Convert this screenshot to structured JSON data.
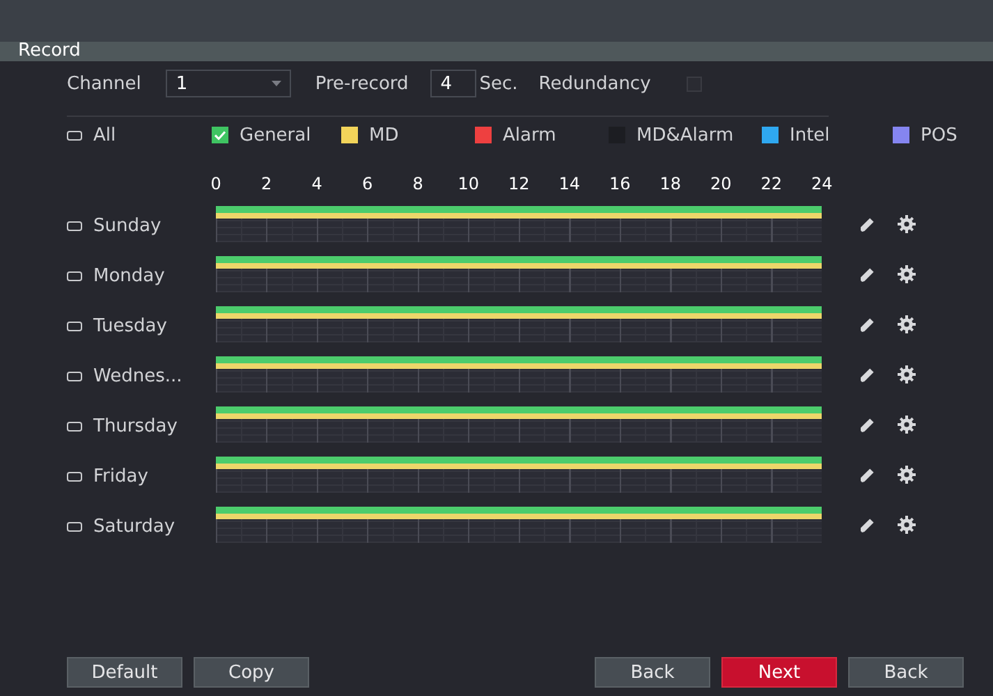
{
  "title": "Record",
  "settings": {
    "channel_label": "Channel",
    "channel_value": "1",
    "prerecord_label": "Pre-record",
    "prerecord_value": "4",
    "prerecord_unit": "Sec.",
    "redundancy_label": "Redundancy",
    "redundancy_checked": false
  },
  "legend": [
    {
      "label": "All",
      "kind": "checkbox",
      "checked": false
    },
    {
      "label": "General",
      "kind": "swatch",
      "color": "#3fc462",
      "checked": true
    },
    {
      "label": "MD",
      "kind": "swatch",
      "color": "#f2d45a",
      "checked": false
    },
    {
      "label": "Alarm",
      "kind": "swatch",
      "color": "#ee4040",
      "checked": false
    },
    {
      "label": "MD&Alarm",
      "kind": "swatch",
      "color": "#1c1d22",
      "checked": false
    },
    {
      "label": "Intel",
      "kind": "swatch",
      "color": "#2fa8f0",
      "checked": false
    },
    {
      "label": "POS",
      "kind": "swatch",
      "color": "#8585f0",
      "checked": false
    }
  ],
  "hours": [
    "0",
    "2",
    "4",
    "6",
    "8",
    "10",
    "12",
    "14",
    "16",
    "18",
    "20",
    "22",
    "24"
  ],
  "days": [
    {
      "label": "Sunday",
      "checked": false,
      "bars": [
        {
          "color": "#4ccc6c",
          "level": 1
        },
        {
          "color": "#ecd66a",
          "level": 1
        }
      ]
    },
    {
      "label": "Monday",
      "checked": false,
      "bars": [
        {
          "color": "#4ccc6c",
          "level": 1
        },
        {
          "color": "#ecd66a",
          "level": 1
        }
      ]
    },
    {
      "label": "Tuesday",
      "checked": false,
      "bars": [
        {
          "color": "#4ccc6c",
          "level": 1
        },
        {
          "color": "#ecd66a",
          "level": 1
        }
      ]
    },
    {
      "label": "Wednes...",
      "checked": false,
      "bars": [
        {
          "color": "#4ccc6c",
          "level": 1
        },
        {
          "color": "#ecd66a",
          "level": 1
        }
      ]
    },
    {
      "label": "Thursday",
      "checked": false,
      "bars": [
        {
          "color": "#4ccc6c",
          "level": 1
        },
        {
          "color": "#ecd66a",
          "level": 1
        }
      ]
    },
    {
      "label": "Friday",
      "checked": false,
      "bars": [
        {
          "color": "#4ccc6c",
          "level": 1
        },
        {
          "color": "#ecd66a",
          "level": 1
        }
      ]
    },
    {
      "label": "Saturday",
      "checked": false,
      "bars": [
        {
          "color": "#4ccc6c",
          "level": 1
        },
        {
          "color": "#ecd66a",
          "level": 1
        }
      ]
    }
  ],
  "buttons_left": [
    {
      "label": "Default",
      "kind": "normal"
    },
    {
      "label": "Copy",
      "kind": "normal"
    }
  ],
  "buttons_right": [
    {
      "label": "Back",
      "kind": "normal"
    },
    {
      "label": "Next",
      "kind": "primary"
    },
    {
      "label": "Back",
      "kind": "normal"
    }
  ]
}
